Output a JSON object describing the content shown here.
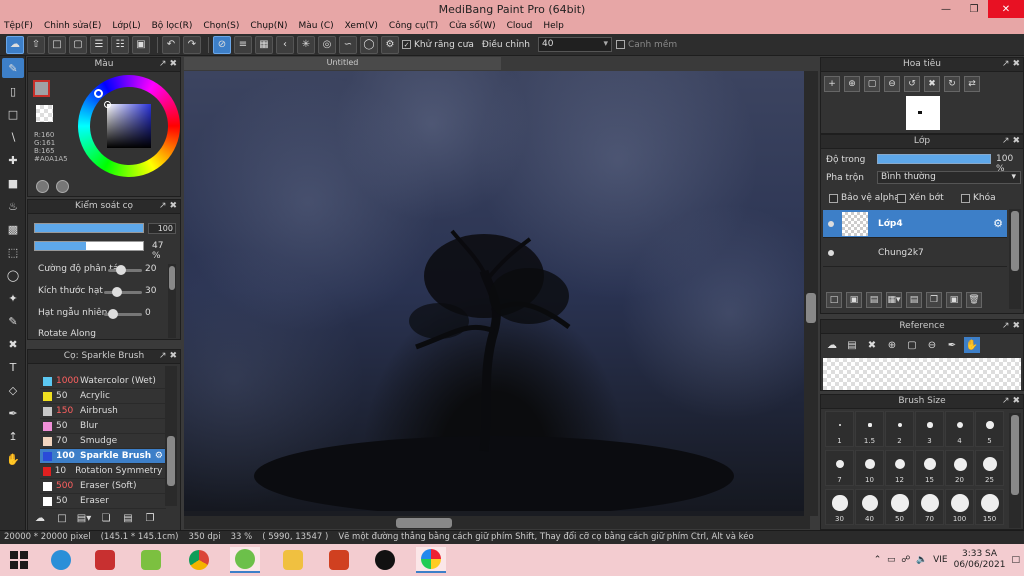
{
  "window": {
    "title": "MediBang Paint Pro (64bit)"
  },
  "menu": [
    "Tệp(F)",
    "Chỉnh sửa(E)",
    "Lớp(L)",
    "Bộ lọc(R)",
    "Chọn(S)",
    "Chụp(N)",
    "Màu (C)",
    "Xem(V)",
    "Công cụ(T)",
    "Cửa sổ(W)",
    "Cloud",
    "Help"
  ],
  "toolbar": {
    "antialias_label": "Khử răng cưa",
    "adjust_label": "Điều chỉnh",
    "adjust_value": "40",
    "smooth_label": "Canh mềm"
  },
  "color_panel": {
    "title": "Màu",
    "rgb": {
      "r": "R:160",
      "g": "G:161",
      "b": "B:165",
      "hex": "#A0A1A5"
    },
    "accent": "#3d7fc8"
  },
  "brush_control": {
    "title": "Kiểm soát cọ",
    "size_value": "100",
    "opacity_value": "47 %",
    "opacity_fraction": 0.47,
    "params": [
      {
        "label": "Cường độ phân tán",
        "value": "20"
      },
      {
        "label": "Kích thước hạt",
        "value": "30"
      },
      {
        "label": "Hạt ngẫu nhiên",
        "value": "0"
      }
    ],
    "cut_label": "Rotate Along"
  },
  "brush_list": {
    "title": "Cọ: Sparkle Brush",
    "items": [
      {
        "size": "1000",
        "name": "Watercolor (Wet)",
        "color": "#5cc8f2",
        "size_red": true
      },
      {
        "size": "50",
        "name": "Acrylic",
        "color": "#f0e020",
        "size_red": false
      },
      {
        "size": "150",
        "name": "Airbrush",
        "color": "#c8c8c8",
        "size_red": true
      },
      {
        "size": "50",
        "name": "Blur",
        "color": "#f090d8",
        "size_red": false
      },
      {
        "size": "70",
        "name": "Smudge",
        "color": "#f3d6c0",
        "size_red": false
      },
      {
        "size": "100",
        "name": "Sparkle Brush",
        "color": "#2a4bd8",
        "size_red": false,
        "selected": true
      },
      {
        "size": "10",
        "name": "Rotation Symmetry Pen",
        "color": "#e02020",
        "size_red": false
      },
      {
        "size": "500",
        "name": "Eraser (Soft)",
        "color": "#ffffff",
        "size_red": true
      },
      {
        "size": "50",
        "name": "Eraser",
        "color": "#ffffff",
        "size_red": false
      }
    ]
  },
  "canvas": {
    "tab_title": "Untitled"
  },
  "navigator": {
    "title": "Hoa tiêu"
  },
  "layers": {
    "title": "Lớp",
    "opacity_label": "Độ trong",
    "opacity_value": "100 %",
    "blend_label": "Pha trộn",
    "blend_value": "Bình thường",
    "protect_alpha": "Bảo vệ alpha",
    "clipping": "Xén bớt",
    "lock": "Khóa",
    "items": [
      {
        "name": "Lớp4",
        "selected": true
      },
      {
        "name": "Chung2k7",
        "selected": false
      }
    ]
  },
  "reference": {
    "title": "Reference"
  },
  "brush_size": {
    "title": "Brush Size",
    "sizes": [
      "1",
      "1.5",
      "2",
      "3",
      "4",
      "5",
      "7",
      "10",
      "12",
      "15",
      "20",
      "25",
      "30",
      "40",
      "50",
      "70",
      "100",
      "150"
    ]
  },
  "status": {
    "canvas_size": "20000 * 20000 pixel",
    "physical": "(145.1 * 145.1cm)",
    "dpi": "350 dpi",
    "zoom": "33 %",
    "coords": "( 5990, 13547 )",
    "hint": "Vẽ một đường thẳng bằng cách giữ phím Shift, Thay đổi cỡ cọ bằng cách giữ phím Ctrl, Alt và kéo"
  },
  "taskbar": {
    "lang": "VIE",
    "time": "3:33 SA",
    "date": "06/06/2021"
  }
}
